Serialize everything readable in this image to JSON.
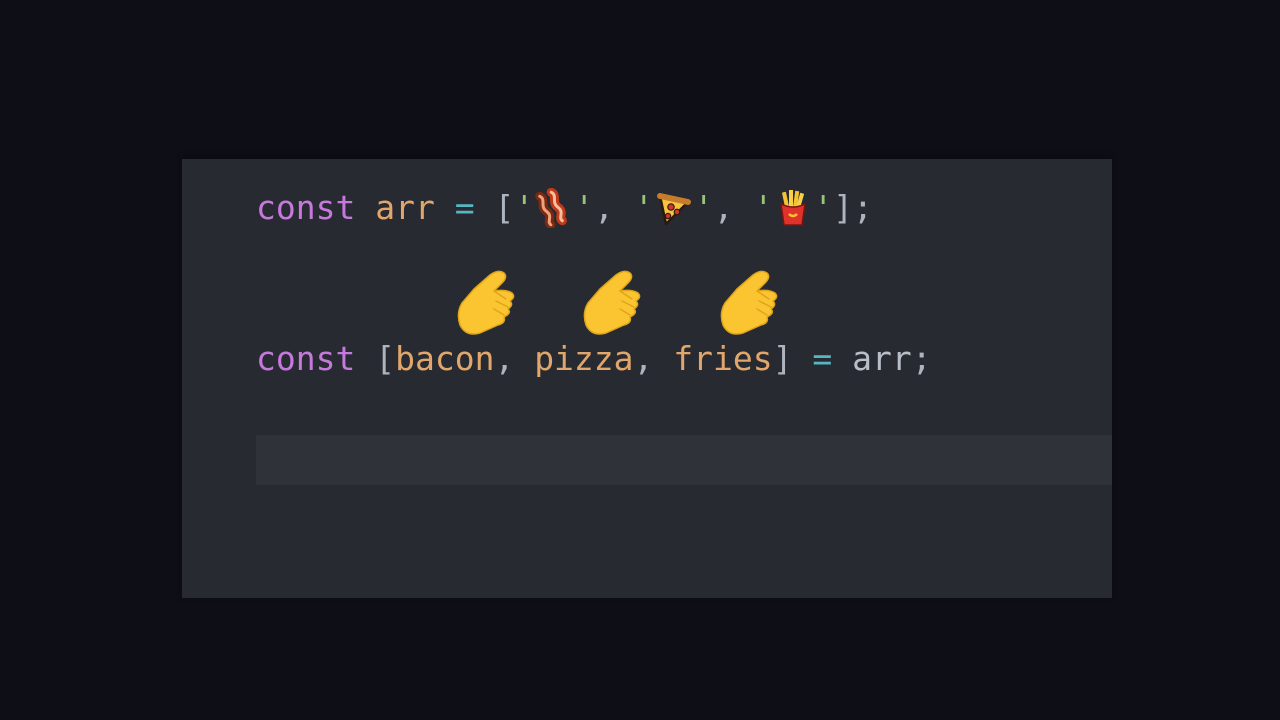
{
  "code": {
    "line1": {
      "keyword": "const",
      "variable": "arr",
      "operator": "=",
      "open_bracket": "[",
      "quote": "'",
      "comma": ",",
      "close": "];",
      "items": [
        {
          "emoji_name": "bacon-emoji"
        },
        {
          "emoji_name": "pizza-emoji"
        },
        {
          "emoji_name": "fries-emoji"
        }
      ]
    },
    "line2": {
      "keyword": "const",
      "open_bracket": "[",
      "names": [
        "bacon",
        "pizza",
        "fries"
      ],
      "comma": ",",
      "close_bracket": "]",
      "operator": "=",
      "source": "arr",
      "semicolon": ";"
    }
  },
  "pointers": [
    {
      "icon": "pointing-hand-icon",
      "target": "bacon"
    },
    {
      "icon": "pointing-hand-icon",
      "target": "pizza"
    },
    {
      "icon": "pointing-hand-icon",
      "target": "fries"
    }
  ],
  "colors": {
    "page_background": "#0e0e16",
    "editor_background": "#272b31",
    "current_line_highlight": "#2f3238",
    "keyword": "#c678dd",
    "variable": "#e0a66b",
    "operator": "#56b6c2",
    "string_quote": "#98c379",
    "punctuation": "#aeb4be",
    "hand_emoji": "#fbc531"
  }
}
